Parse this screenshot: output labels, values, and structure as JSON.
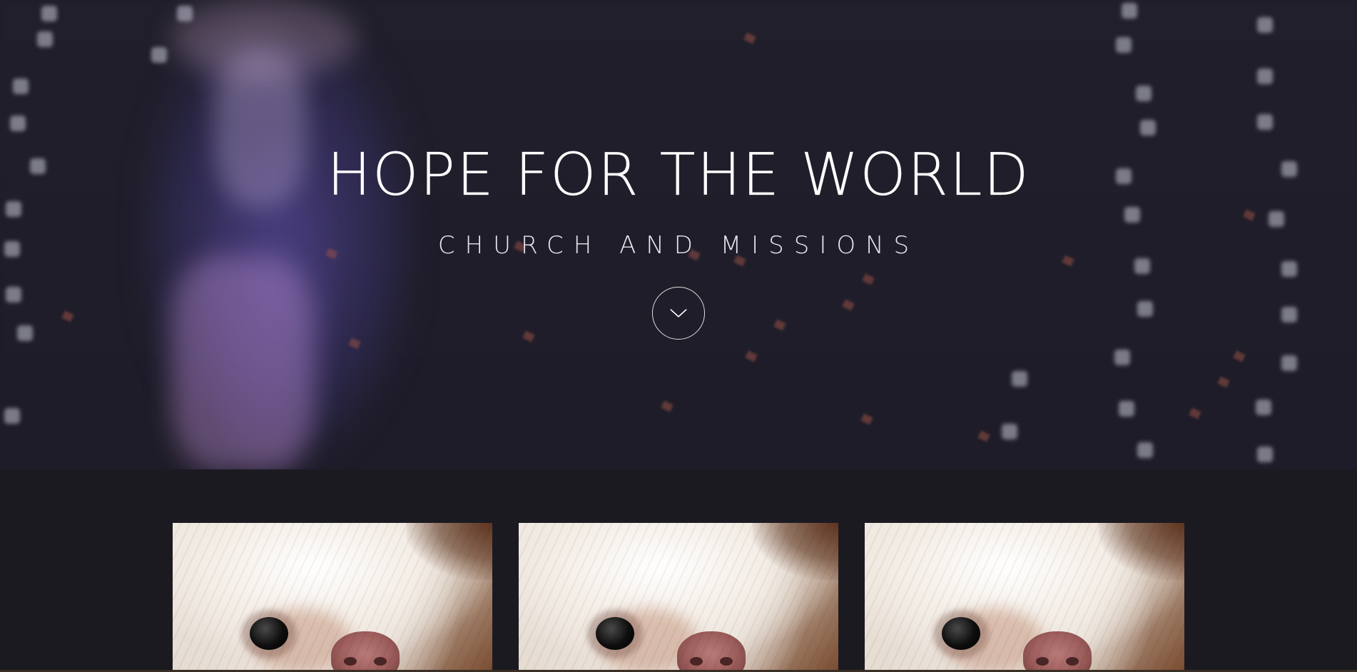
{
  "hero": {
    "title": "HOPE FOR THE WORLD",
    "subtitle": "CHURCH AND MISSIONS",
    "scroll_icon": "chevron-down-icon"
  },
  "gallery": {
    "cards": [
      {
        "image": "white dog close-up photo"
      },
      {
        "image": "white dog close-up photo"
      },
      {
        "image": "white dog close-up photo"
      }
    ]
  },
  "colors": {
    "background": "#1c1b23",
    "hero_overlay": "#1f1d2a",
    "text": "#ffffff"
  }
}
